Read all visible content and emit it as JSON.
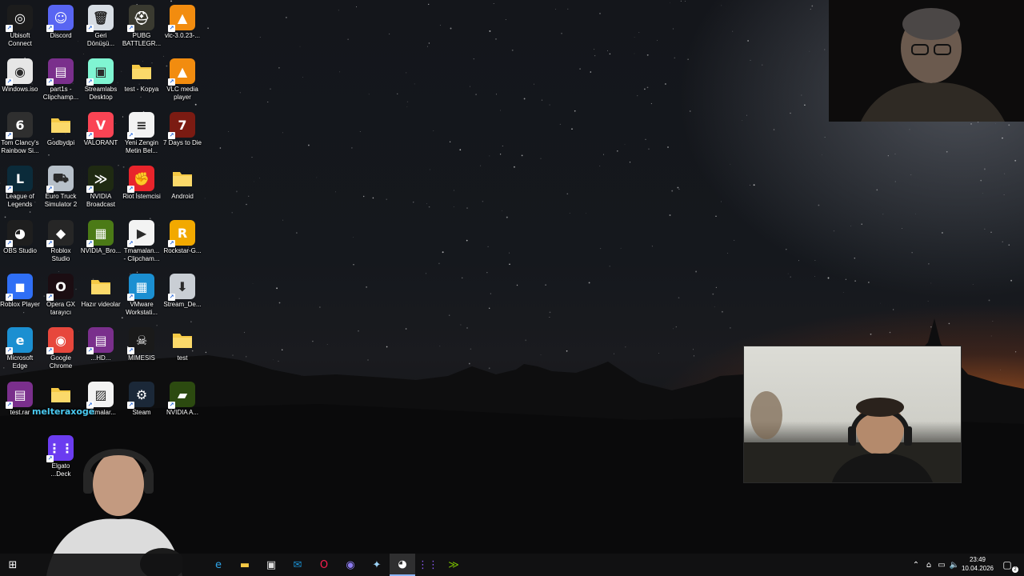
{
  "desktop": {
    "icons": [
      {
        "label": "Ubisoft\nConnect",
        "icon": "ubisoft-icon",
        "color": "#1c1c1c",
        "glyph": "◎"
      },
      {
        "label": "Discord",
        "icon": "discord-icon",
        "color": "#5865f2",
        "glyph": "☺"
      },
      {
        "label": "Geri\nDönüşü...",
        "icon": "recycle-bin-icon",
        "color": "#d7dde4",
        "glyph": "🗑"
      },
      {
        "label": "PUBG\nBATTLEGR...",
        "icon": "pubg-icon",
        "color": "#3a3a30",
        "glyph": "⛑"
      },
      {
        "label": "vlc-3.0.23-...",
        "icon": "vlc-installer-icon",
        "color": "#f28c0f",
        "glyph": "▲"
      },
      {
        "label": "Windows.iso",
        "icon": "disc-image-icon",
        "color": "#e6e6e6",
        "glyph": "◉"
      },
      {
        "label": "part1s -\nClipchamp...",
        "icon": "winrar-icon",
        "color": "#7a2f8c",
        "glyph": "▤"
      },
      {
        "label": "Streamlabs\nDesktop",
        "icon": "streamlabs-icon",
        "color": "#80f5d2",
        "glyph": "▣"
      },
      {
        "label": "test - Kopya",
        "icon": "folder-icon",
        "color": "#f5c945",
        "glyph": ""
      },
      {
        "label": "VLC media\nplayer",
        "icon": "vlc-icon",
        "color": "#f28c0f",
        "glyph": "▲"
      },
      {
        "label": "Tom Clancy's\nRainbow Si...",
        "icon": "rainbow-six-icon",
        "color": "#2f2f2f",
        "glyph": "6"
      },
      {
        "label": "Godbydpi",
        "icon": "folder-icon",
        "color": "#f5c945",
        "glyph": ""
      },
      {
        "label": "VALORANT",
        "icon": "valorant-icon",
        "color": "#fa4454",
        "glyph": "V"
      },
      {
        "label": "Yeni Zengin\nMetin Bel...",
        "icon": "document-icon",
        "color": "#f3f3f3",
        "glyph": "≡"
      },
      {
        "label": "7 Days to Die",
        "icon": "seven-days-icon",
        "color": "#7b1b12",
        "glyph": "7"
      },
      {
        "label": "League of\nLegends",
        "icon": "league-icon",
        "color": "#0b2b3a",
        "glyph": "L"
      },
      {
        "label": "Euro Truck\nSimulator 2",
        "icon": "truck-icon",
        "color": "#b7c0c9",
        "glyph": "⛟"
      },
      {
        "label": "NVIDIA\nBroadcast",
        "icon": "nvidia-broadcast-icon",
        "color": "#1f2a12",
        "glyph": "≫"
      },
      {
        "label": "Riot İstemcisi",
        "icon": "riot-icon",
        "color": "#e8242b",
        "glyph": "✊"
      },
      {
        "label": "Android",
        "icon": "folder-icon",
        "color": "#f5c945",
        "glyph": ""
      },
      {
        "label": "OBS Studio",
        "icon": "obs-icon",
        "color": "#1e1e1e",
        "glyph": "◕"
      },
      {
        "label": "Roblox\nStudio",
        "icon": "roblox-studio-icon",
        "color": "#262626",
        "glyph": "◆"
      },
      {
        "label": "NVIDIA_Bro...",
        "icon": "nvidia-installer-icon",
        "color": "#4b7a16",
        "glyph": "▦"
      },
      {
        "label": "Tmamalan...\n- Clipcham...",
        "icon": "video-file-icon",
        "color": "#f3f3f3",
        "glyph": "▶"
      },
      {
        "label": "Rockstar-G...",
        "icon": "rockstar-icon",
        "color": "#f2a900",
        "glyph": "R"
      },
      {
        "label": "Roblox Player",
        "icon": "roblox-player-icon",
        "color": "#2f6ff5",
        "glyph": "◼"
      },
      {
        "label": "Opera GX\ntarayıcı",
        "icon": "opera-gx-icon",
        "color": "#1b0d12",
        "glyph": "O"
      },
      {
        "label": "Hazır videolar",
        "icon": "folder-icon",
        "color": "#f5c945",
        "glyph": ""
      },
      {
        "label": "VMware\nWorkstati...",
        "icon": "vmware-icon",
        "color": "#1b8fd1",
        "glyph": "▦"
      },
      {
        "label": "Stream_De...",
        "icon": "installer-icon",
        "color": "#c9ced4",
        "glyph": "⬇"
      },
      {
        "label": "Microsoft\nEdge",
        "icon": "edge-icon",
        "color": "#1b8fd1",
        "glyph": "e"
      },
      {
        "label": "Google\nChrome",
        "icon": "chrome-icon",
        "color": "#e7473c",
        "glyph": "◉"
      },
      {
        "label": "...HD...",
        "icon": "winrar-icon",
        "color": "#7a2f8c",
        "glyph": "▤"
      },
      {
        "label": "MIMESIS",
        "icon": "mimesis-icon",
        "color": "#1a1a1a",
        "glyph": "☠"
      },
      {
        "label": "test",
        "icon": "folder-icon",
        "color": "#f5c945",
        "glyph": ""
      },
      {
        "label": "test.rar",
        "icon": "winrar-icon",
        "color": "#7a2f8c",
        "glyph": "▤"
      },
      {
        "label": "",
        "icon": "folder-icon",
        "color": "#f5c945",
        "glyph": ""
      },
      {
        "label": "...rtmalar...",
        "icon": "image-file-icon",
        "color": "#f3f3f3",
        "glyph": "▨"
      },
      {
        "label": "Steam",
        "icon": "steam-icon",
        "color": "#1b2838",
        "glyph": "⚙"
      },
      {
        "label": "NVIDIA A...",
        "icon": "nvidia-app-icon",
        "color": "#2c4a10",
        "glyph": "▰"
      },
      {
        "label": "",
        "icon": "blank-icon",
        "color": "transparent",
        "glyph": ""
      },
      {
        "label": "Elgato\n...Deck",
        "icon": "elgato-stream-deck-icon",
        "color": "#6b3cf0",
        "glyph": "⋮⋮"
      }
    ]
  },
  "overlay": {
    "username": "melteraxoge"
  },
  "taskbar": {
    "buttons": [
      {
        "name": "start-button",
        "icon": "windows-logo-icon",
        "glyph": "⊞",
        "color": "#ffffff"
      },
      {
        "name": "taskbar-edge",
        "icon": "edge-icon",
        "glyph": "e",
        "color": "#2ea4e8"
      },
      {
        "name": "taskbar-file-explorer",
        "icon": "folder-icon",
        "glyph": "▬",
        "color": "#f5c945"
      },
      {
        "name": "taskbar-store",
        "icon": "store-icon",
        "glyph": "▣",
        "color": "#e0e0e0"
      },
      {
        "name": "taskbar-mail",
        "icon": "mail-icon",
        "glyph": "✉",
        "color": "#1b8fd1"
      },
      {
        "name": "taskbar-opera-gx",
        "icon": "opera-gx-icon",
        "glyph": "O",
        "color": "#fa1e4e"
      },
      {
        "name": "taskbar-chrome",
        "icon": "chrome-icon",
        "glyph": "◉",
        "color": "#8d7cf0"
      },
      {
        "name": "taskbar-app",
        "icon": "settings-app-icon",
        "glyph": "✦",
        "color": "#9bd1f5"
      },
      {
        "name": "taskbar-obs",
        "icon": "obs-icon",
        "glyph": "◕",
        "color": "#ffffff"
      },
      {
        "name": "taskbar-elgato",
        "icon": "elgato-icon",
        "glyph": "⋮⋮",
        "color": "#8a5cf5"
      },
      {
        "name": "taskbar-nvidia-broadcast",
        "icon": "nvidia-broadcast-icon",
        "glyph": "≫",
        "color": "#76b900"
      }
    ],
    "tray": {
      "time": "23:49",
      "date": "10.04.2026",
      "notification_count": "2"
    }
  }
}
